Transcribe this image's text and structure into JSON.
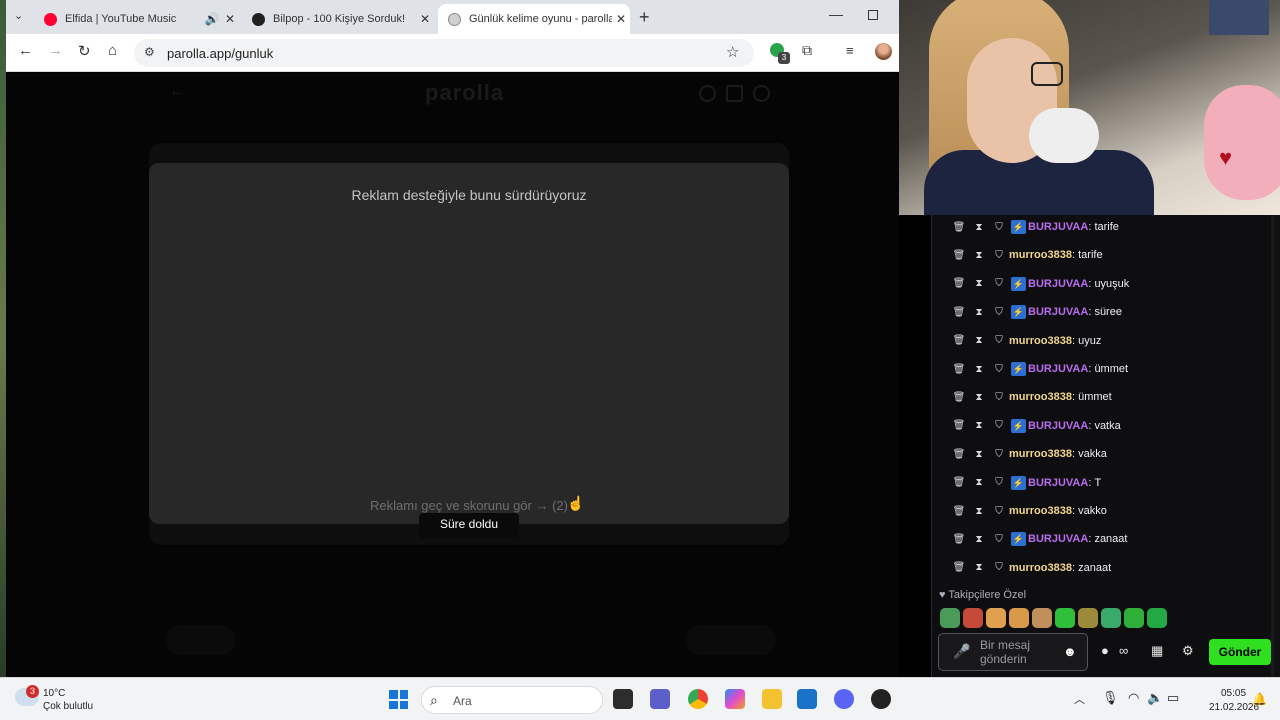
{
  "browser": {
    "tabs": [
      {
        "title": "Elfida | YouTube Music",
        "favicon_color": "#ff0033"
      },
      {
        "title": "Bilpop - 100 Kişiye Sorduk!",
        "favicon_color": "#202020"
      },
      {
        "title": "Günlük kelime oyunu - parolla",
        "favicon_color": "#8a8a8a"
      }
    ],
    "url": "parolla.app/gunluk",
    "extension_badge": "3"
  },
  "page": {
    "logo": "parolla",
    "ad_title": "Reklam desteğiyle bunu sürdürüyoruz",
    "skip_link": "Reklamı geç ve skorunu gör → (2)",
    "timeout_badge": "Süre doldu"
  },
  "chat": {
    "messages": [
      {
        "user": "BURJUVAA",
        "text": "tarife",
        "badge": true,
        "color": "#b86cf0"
      },
      {
        "user": "murroo3838",
        "text": "tarife",
        "badge": false,
        "color": "#f2d68e"
      },
      {
        "user": "BURJUVAA",
        "text": "uyuşuk",
        "badge": true,
        "color": "#b86cf0"
      },
      {
        "user": "BURJUVAA",
        "text": "süree",
        "badge": true,
        "color": "#b86cf0"
      },
      {
        "user": "murroo3838",
        "text": "uyuz",
        "badge": false,
        "color": "#f2d68e"
      },
      {
        "user": "BURJUVAA",
        "text": "ümmet",
        "badge": true,
        "color": "#b86cf0"
      },
      {
        "user": "murroo3838",
        "text": "ümmet",
        "badge": false,
        "color": "#f2d68e"
      },
      {
        "user": "BURJUVAA",
        "text": "vatka",
        "badge": true,
        "color": "#b86cf0"
      },
      {
        "user": "murroo3838",
        "text": "vakka",
        "badge": false,
        "color": "#f2d68e"
      },
      {
        "user": "BURJUVAA",
        "text": "T",
        "badge": true,
        "color": "#b86cf0"
      },
      {
        "user": "murroo3838",
        "text": "vakko",
        "badge": false,
        "color": "#f2d68e"
      },
      {
        "user": "BURJUVAA",
        "text": "zanaat",
        "badge": true,
        "color": "#b86cf0"
      },
      {
        "user": "murroo3838",
        "text": "zanaat",
        "badge": false,
        "color": "#f2d68e"
      }
    ],
    "followers_label": "Takipçilere Özel",
    "input_placeholder": "Bir mesaj gönderin",
    "send_label": "Gönder"
  },
  "taskbar": {
    "weather_temp": "10°C",
    "weather_condition": "Çok bulutlu",
    "weather_badge": "3",
    "search_placeholder": "Ara",
    "time": "05:05",
    "date": "21.02.2026"
  }
}
